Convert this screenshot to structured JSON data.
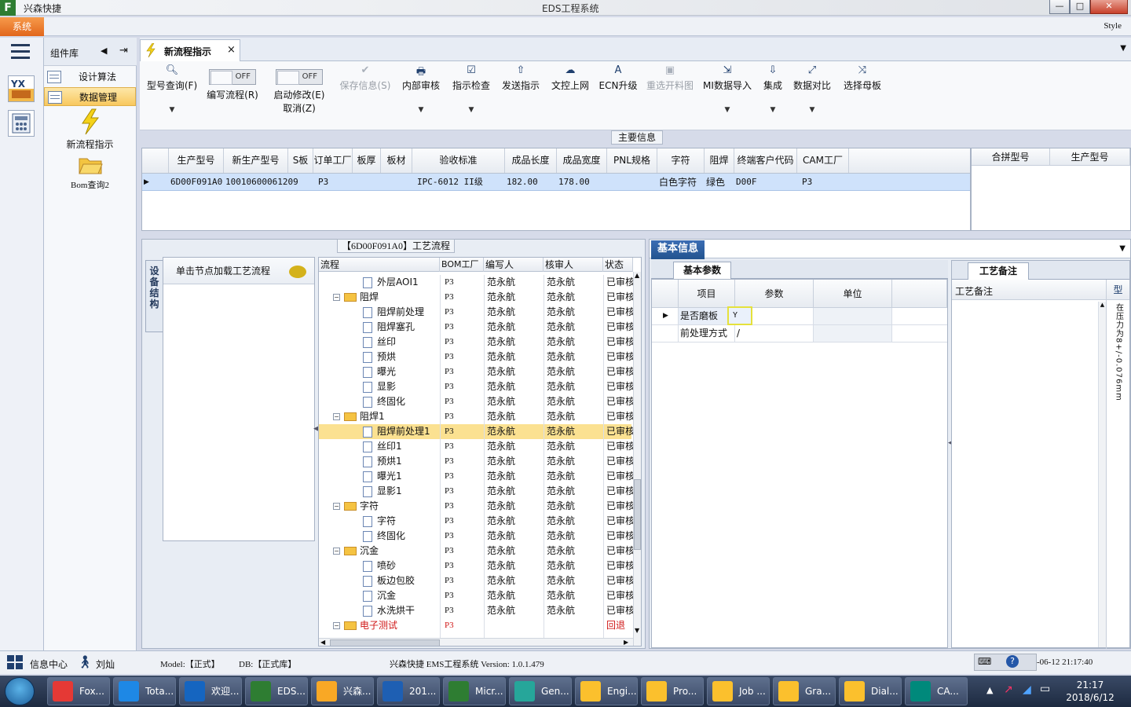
{
  "window": {
    "app_name": "兴森快捷",
    "title": "EDS工程系统",
    "min": "—",
    "max": "□",
    "close": "✕"
  },
  "menubar": {
    "system": "系统",
    "style": "Style"
  },
  "component_panel": {
    "title": "组件库",
    "items": [
      {
        "label": "设计算法"
      },
      {
        "label": "数据管理"
      }
    ],
    "big_items": [
      {
        "label": "新流程指示"
      },
      {
        "label": "Bom查询2"
      }
    ]
  },
  "tabs": {
    "active": "新流程指示",
    "close": "×"
  },
  "toolbar": {
    "type_query": "型号查询(F)",
    "edit_flow": "编写流程(R)",
    "start_edit": "启动修改(E)",
    "cancel": "取消(Z)",
    "toggle_off": "OFF",
    "save_info": "保存信息(S)",
    "internal_review": "内部审核",
    "check_instr": "指示检查",
    "send_instr": "发送指示",
    "upload_doc": "文控上网",
    "ecn_upgrade": "ECN升级",
    "reselect_img": "重选开料图",
    "mi_import": "MI数据导入",
    "integrate": "集成",
    "compare": "数据对比",
    "select_master": "选择母板"
  },
  "main_info": {
    "label": "主要信息",
    "columns": [
      "生产型号",
      "新生产型号",
      "S板",
      "订单工厂",
      "板厚",
      "板材",
      "验收标准",
      "成品长度",
      "成品宽度",
      "PNL规格",
      "字符",
      "阻焊",
      "终端客户代码",
      "CAM工厂"
    ],
    "row": [
      "6D00F091A0",
      "10010600061209",
      "",
      "P3",
      "",
      "",
      "IPC-6012 II级",
      "182.00",
      "178.00",
      "",
      "白色字符",
      "绿色",
      "D00F",
      "P3"
    ],
    "side_columns": [
      "合拼型号",
      "生产型号"
    ]
  },
  "process": {
    "label": "【6D00F091A0】工艺流程",
    "vtab": "设备结构",
    "node_hint": "单击节点加载工艺流程",
    "columns": [
      "流程",
      "BOM工厂",
      "编写人",
      "核审人",
      "状态"
    ],
    "rows": [
      {
        "name": "外层AOI1",
        "level": 2,
        "type": "doc",
        "factory": "P3",
        "author": "范永航",
        "reviewer": "范永航",
        "status": "已审核"
      },
      {
        "name": "阻焊",
        "level": 1,
        "type": "folder",
        "factory": "P3",
        "author": "范永航",
        "reviewer": "范永航",
        "status": "已审核"
      },
      {
        "name": "阻焊前处理",
        "level": 2,
        "type": "doc",
        "factory": "P3",
        "author": "范永航",
        "reviewer": "范永航",
        "status": "已审核"
      },
      {
        "name": "阻焊塞孔",
        "level": 2,
        "type": "doc",
        "factory": "P3",
        "author": "范永航",
        "reviewer": "范永航",
        "status": "已审核"
      },
      {
        "name": "丝印",
        "level": 2,
        "type": "doc",
        "factory": "P3",
        "author": "范永航",
        "reviewer": "范永航",
        "status": "已审核"
      },
      {
        "name": "预烘",
        "level": 2,
        "type": "doc",
        "factory": "P3",
        "author": "范永航",
        "reviewer": "范永航",
        "status": "已审核"
      },
      {
        "name": "曝光",
        "level": 2,
        "type": "doc",
        "factory": "P3",
        "author": "范永航",
        "reviewer": "范永航",
        "status": "已审核"
      },
      {
        "name": "显影",
        "level": 2,
        "type": "doc",
        "factory": "P3",
        "author": "范永航",
        "reviewer": "范永航",
        "status": "已审核"
      },
      {
        "name": "终固化",
        "level": 2,
        "type": "doc",
        "factory": "P3",
        "author": "范永航",
        "reviewer": "范永航",
        "status": "已审核"
      },
      {
        "name": "阻焊1",
        "level": 1,
        "type": "folder",
        "factory": "P3",
        "author": "范永航",
        "reviewer": "范永航",
        "status": "已审核"
      },
      {
        "name": "阻焊前处理1",
        "level": 2,
        "type": "doc",
        "factory": "P3",
        "author": "范永航",
        "reviewer": "范永航",
        "status": "已审核",
        "selected": true
      },
      {
        "name": "丝印1",
        "level": 2,
        "type": "doc",
        "factory": "P3",
        "author": "范永航",
        "reviewer": "范永航",
        "status": "已审核"
      },
      {
        "name": "预烘1",
        "level": 2,
        "type": "doc",
        "factory": "P3",
        "author": "范永航",
        "reviewer": "范永航",
        "status": "已审核"
      },
      {
        "name": "曝光1",
        "level": 2,
        "type": "doc",
        "factory": "P3",
        "author": "范永航",
        "reviewer": "范永航",
        "status": "已审核"
      },
      {
        "name": "显影1",
        "level": 2,
        "type": "doc",
        "factory": "P3",
        "author": "范永航",
        "reviewer": "范永航",
        "status": "已审核"
      },
      {
        "name": "字符",
        "level": 1,
        "type": "folder",
        "factory": "P3",
        "author": "范永航",
        "reviewer": "范永航",
        "status": "已审核"
      },
      {
        "name": "字符",
        "level": 2,
        "type": "doc",
        "factory": "P3",
        "author": "范永航",
        "reviewer": "范永航",
        "status": "已审核"
      },
      {
        "name": "终固化",
        "level": 2,
        "type": "doc",
        "factory": "P3",
        "author": "范永航",
        "reviewer": "范永航",
        "status": "已审核"
      },
      {
        "name": "沉金",
        "level": 1,
        "type": "folder",
        "factory": "P3",
        "author": "范永航",
        "reviewer": "范永航",
        "status": "已审核"
      },
      {
        "name": "喷砂",
        "level": 2,
        "type": "doc",
        "factory": "P3",
        "author": "范永航",
        "reviewer": "范永航",
        "status": "已审核"
      },
      {
        "name": "板边包胶",
        "level": 2,
        "type": "doc",
        "factory": "P3",
        "author": "范永航",
        "reviewer": "范永航",
        "status": "已审核"
      },
      {
        "name": "沉金",
        "level": 2,
        "type": "doc",
        "factory": "P3",
        "author": "范永航",
        "reviewer": "范永航",
        "status": "已审核"
      },
      {
        "name": "水洗烘干",
        "level": 2,
        "type": "doc",
        "factory": "P3",
        "author": "范永航",
        "reviewer": "范永航",
        "status": "已审核"
      },
      {
        "name": "电子测试",
        "level": 1,
        "type": "folder",
        "factory": "P3",
        "author": "",
        "reviewer": "",
        "status": "回退",
        "red": true
      }
    ]
  },
  "basic_info": {
    "tab": "基本信息",
    "param_tab": "基本参数",
    "columns": [
      "项目",
      "参数",
      "单位"
    ],
    "rows": [
      {
        "item": "是否磨板",
        "param": "Y",
        "unit": ""
      },
      {
        "item": "前处理方式",
        "param": "/",
        "unit": ""
      }
    ],
    "note_tab": "工艺备注",
    "note_col": "工艺备注",
    "note_col2": "型",
    "note_vertical": "在压力为8+/-0.076mm"
  },
  "statusbar": {
    "info_center": "信息中心",
    "user": "刘灿",
    "model": "Model:【正式】",
    "db": "DB:【正式库】",
    "product": "兴森快捷 EMS工程系统 Version: 1.0.1.479",
    "time": "-06-12 21:17:40"
  },
  "taskbar": {
    "items": [
      "Fox...",
      "Tota...",
      "欢迎...",
      "EDS...",
      "兴森...",
      "201...",
      "Micr...",
      "Gen...",
      "Engi...",
      "Pro...",
      "Job ...",
      "Gra...",
      "Dial...",
      "CA..."
    ],
    "clock_time": "21:17",
    "clock_date": "2018/6/12"
  },
  "colors": {
    "accent_orange": "#e1661c",
    "selection_yellow": "#fbe191",
    "row_blue": "#cfe2fb",
    "tab_blue": "#23538f",
    "alert_red": "#d01818"
  }
}
